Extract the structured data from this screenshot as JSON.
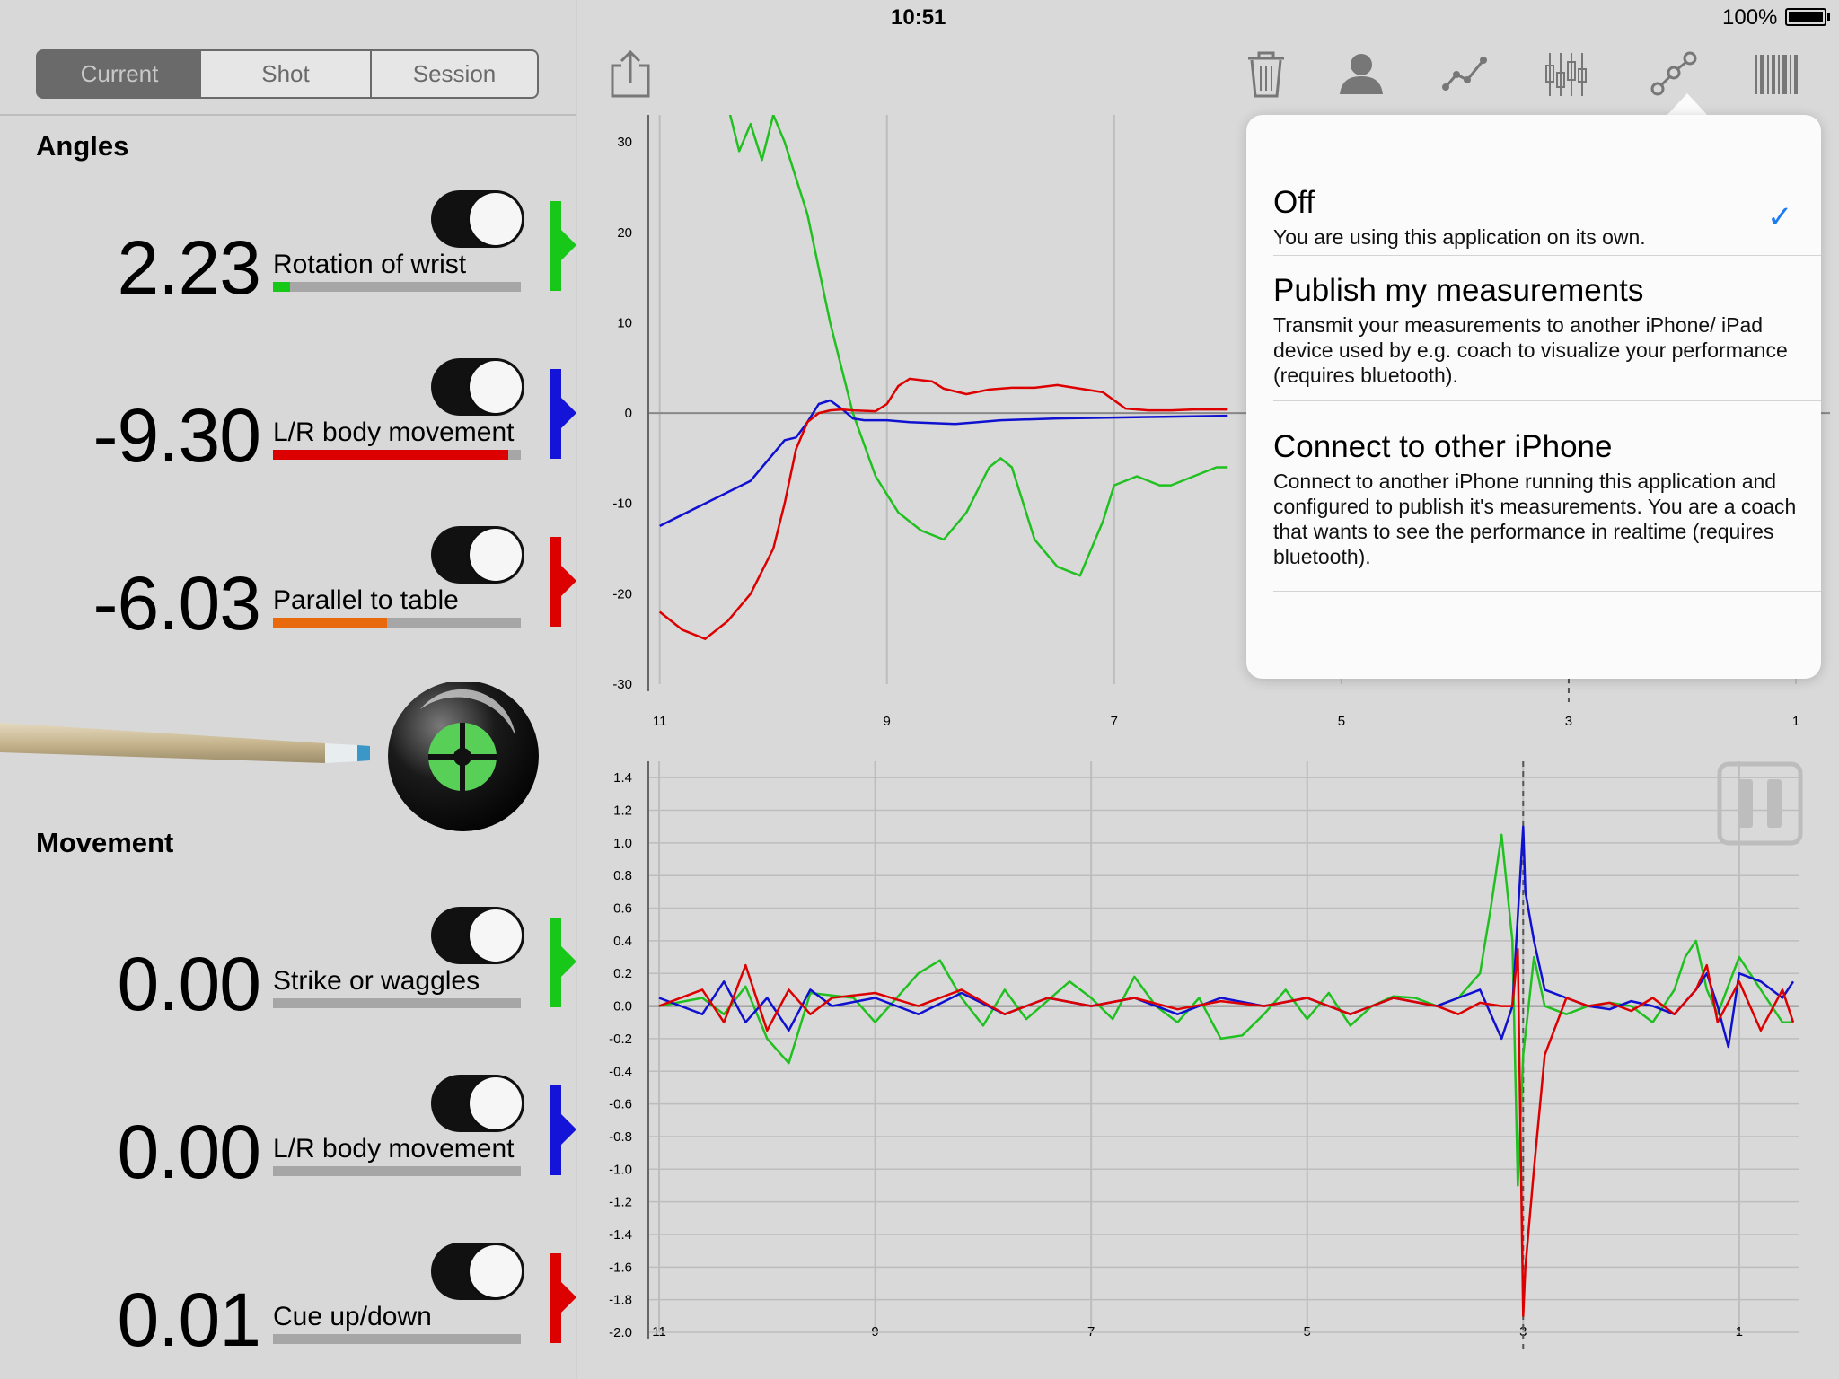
{
  "status_bar": {
    "device": "iPad",
    "time": "10:51",
    "battery": "100%"
  },
  "tabs": {
    "current": "Current",
    "shot": "Shot",
    "session": "Session",
    "active": "current"
  },
  "angles": {
    "title": "Angles",
    "items": [
      {
        "value": "2.23",
        "label": "Rotation of wrist",
        "bar_color": "#18c818",
        "bar_fill": 0.07,
        "flag_color": "#18c818",
        "enabled": true
      },
      {
        "value": "-9.30",
        "label": "L/R body movement",
        "bar_color": "#dd0000",
        "bar_fill": 0.95,
        "flag_color": "#1414d8",
        "enabled": true
      },
      {
        "value": "-6.03",
        "label": "Parallel to table",
        "bar_color": "#e86a0c",
        "bar_fill": 0.46,
        "flag_color": "#dd0000",
        "enabled": true
      }
    ]
  },
  "movement": {
    "title": "Movement",
    "items": [
      {
        "value": "0.00",
        "label": "Strike or waggles",
        "bar_color": "#18c818",
        "bar_fill": 0.0,
        "flag_color": "#18c818",
        "enabled": true
      },
      {
        "value": "0.00",
        "label": "L/R body movement",
        "bar_color": "#1414d8",
        "bar_fill": 0.0,
        "flag_color": "#1414d8",
        "enabled": true
      },
      {
        "value": "0.01",
        "label": "Cue up/down",
        "bar_color": "#dd0000",
        "bar_fill": 0.0,
        "flag_color": "#dd0000",
        "enabled": true
      }
    ]
  },
  "toolbar": {
    "icons": [
      "share-icon",
      "trash-icon",
      "person-icon",
      "line-chart-icon",
      "candlestick-icon",
      "connect-icon",
      "barcode-icon"
    ]
  },
  "popover": {
    "options": [
      {
        "title": "Off",
        "desc": "You are using this application on its own.",
        "selected": true
      },
      {
        "title": "Publish my measurements",
        "desc": "Transmit your measurements to another iPhone/ iPad device used by e.g. coach to visualize your performance (requires bluetooth).",
        "selected": false
      },
      {
        "title": "Connect to other iPhone",
        "desc": "Connect to another iPhone running this application and configured to publish it's measurements. You are a coach that wants to see the performance in realtime (requires bluetooth).",
        "selected": false
      }
    ],
    "check_glyph": "✓"
  },
  "chart_data": [
    {
      "type": "line",
      "title": "",
      "xlabel": "",
      "ylabel": "",
      "x_ticks": [
        "11",
        "9",
        "7",
        "5",
        "3",
        "1"
      ],
      "y_ticks": [
        "30",
        "20",
        "10",
        "0",
        "-10",
        "-20",
        "-30"
      ],
      "xlim": [
        11.1,
        0.7
      ],
      "ylim": [
        -30,
        33
      ],
      "grid": true,
      "marker_x": 3,
      "series": [
        {
          "color": "#20c020",
          "x": [
            10.4,
            10.3,
            10.2,
            10.1,
            10.0,
            9.9,
            9.7,
            9.5,
            9.3,
            9.1,
            8.9,
            8.7,
            8.5,
            8.3,
            8.1,
            8.0,
            7.9,
            7.8,
            7.7,
            7.5,
            7.3,
            7.1,
            7.0,
            6.8,
            6.6,
            6.5,
            6.3,
            6.1,
            6.0
          ],
          "y": [
            34,
            29,
            32,
            28,
            33,
            30,
            22,
            10,
            0,
            -7,
            -11,
            -13,
            -14,
            -11,
            -6,
            -5,
            -6,
            -10,
            -14,
            -17,
            -18,
            -12,
            -8,
            -7,
            -8,
            -8,
            -7,
            -6,
            -6
          ]
        },
        {
          "color": "#1010d0",
          "x": [
            11.0,
            10.6,
            10.2,
            10.0,
            9.9,
            9.8,
            9.7,
            9.6,
            9.5,
            9.4,
            9.3,
            9.2,
            9.0,
            8.8,
            8.6,
            8.4,
            8.2,
            8.0,
            7.5,
            7.0,
            6.5,
            6.0
          ],
          "y": [
            -12.5,
            -10,
            -7.5,
            -4.5,
            -3,
            -2.7,
            -1,
            1,
            1.4,
            0.5,
            -0.6,
            -0.8,
            -0.8,
            -1,
            -1.1,
            -1.2,
            -1,
            -0.8,
            -0.6,
            -0.5,
            -0.4,
            -0.3
          ]
        },
        {
          "color": "#dd0000",
          "x": [
            11.0,
            10.8,
            10.6,
            10.4,
            10.2,
            10.0,
            9.9,
            9.8,
            9.7,
            9.6,
            9.5,
            9.4,
            9.3,
            9.1,
            9.0,
            8.9,
            8.8,
            8.6,
            8.5,
            8.3,
            8.1,
            7.9,
            7.7,
            7.5,
            7.3,
            7.1,
            6.9,
            6.7,
            6.5,
            6.3,
            6.0
          ],
          "y": [
            -22,
            -24,
            -25,
            -23,
            -20,
            -15,
            -10,
            -4,
            -1,
            0,
            0.3,
            0.4,
            0.3,
            0.2,
            1,
            3,
            3.8,
            3.5,
            2.7,
            2.1,
            2.6,
            2.8,
            2.8,
            3.1,
            2.7,
            2.3,
            0.5,
            0.3,
            0.3,
            0.4,
            0.4
          ]
        }
      ]
    },
    {
      "type": "line",
      "title": "",
      "xlabel": "",
      "ylabel": "",
      "x_ticks": [
        "11",
        "9",
        "7",
        "5",
        "3",
        "1"
      ],
      "y_ticks": [
        "1.4",
        "1.2",
        "1.0",
        "0.8",
        "0.6",
        "0.4",
        "0.2",
        "0.0",
        "-0.2",
        "-0.4",
        "-0.6",
        "-0.8",
        "-1.0",
        "-1.2",
        "-1.4",
        "-1.6",
        "-1.8",
        "-2.0"
      ],
      "xlim": [
        11.1,
        0.45
      ],
      "ylim": [
        -2.0,
        1.5
      ],
      "grid": true,
      "marker_x": 3,
      "series": [
        {
          "color": "#20c020",
          "x": [
            11.0,
            10.6,
            10.4,
            10.2,
            10.0,
            9.8,
            9.6,
            9.2,
            9.0,
            8.6,
            8.4,
            8.2,
            8.0,
            7.8,
            7.6,
            7.2,
            7.0,
            6.8,
            6.6,
            6.4,
            6.2,
            6.0,
            5.8,
            5.6,
            5.4,
            5.2,
            5.0,
            4.8,
            4.6,
            4.4,
            4.2,
            4.0,
            3.8,
            3.6,
            3.4,
            3.3,
            3.2,
            3.1,
            3.05,
            3.0,
            2.9,
            2.8,
            2.6,
            2.4,
            2.2,
            2.0,
            1.8,
            1.6,
            1.5,
            1.4,
            1.3,
            1.2,
            1.0,
            0.8,
            0.6,
            0.5
          ],
          "y": [
            0.0,
            0.05,
            -0.05,
            0.12,
            -0.2,
            -0.35,
            0.08,
            0.05,
            -0.1,
            0.2,
            0.28,
            0.05,
            -0.12,
            0.1,
            -0.08,
            0.15,
            0.05,
            -0.08,
            0.18,
            0.0,
            -0.1,
            0.05,
            -0.2,
            -0.18,
            -0.05,
            0.1,
            -0.08,
            0.08,
            -0.12,
            0.0,
            0.06,
            0.05,
            0.0,
            0.05,
            0.2,
            0.6,
            1.05,
            0.4,
            -1.1,
            -0.3,
            0.3,
            0.0,
            -0.05,
            0.0,
            0.02,
            0.0,
            -0.1,
            0.1,
            0.3,
            0.4,
            0.1,
            -0.05,
            0.3,
            0.1,
            -0.1,
            -0.1
          ]
        },
        {
          "color": "#1010d0",
          "x": [
            11.0,
            10.6,
            10.4,
            10.2,
            10.0,
            9.8,
            9.6,
            9.4,
            9.0,
            8.6,
            8.2,
            7.8,
            7.4,
            7.0,
            6.6,
            6.2,
            5.8,
            5.4,
            5.0,
            4.6,
            4.2,
            3.8,
            3.6,
            3.4,
            3.2,
            3.1,
            3.05,
            3.0,
            2.98,
            2.9,
            2.8,
            2.6,
            2.4,
            2.2,
            2.0,
            1.8,
            1.6,
            1.4,
            1.3,
            1.2,
            1.1,
            1.0,
            0.8,
            0.6,
            0.5
          ],
          "y": [
            0.05,
            -0.05,
            0.15,
            -0.1,
            0.05,
            -0.15,
            0.1,
            0.0,
            0.05,
            -0.05,
            0.08,
            -0.05,
            0.05,
            0.0,
            0.05,
            -0.05,
            0.05,
            0.0,
            0.05,
            -0.05,
            0.05,
            0.0,
            0.05,
            0.1,
            -0.2,
            0.0,
            0.55,
            1.1,
            0.7,
            0.4,
            0.1,
            0.05,
            0.0,
            -0.02,
            0.03,
            0.0,
            -0.05,
            0.1,
            0.2,
            0.0,
            -0.25,
            0.2,
            0.15,
            0.05,
            0.15
          ]
        },
        {
          "color": "#dd0000",
          "x": [
            11.0,
            10.6,
            10.4,
            10.2,
            10.0,
            9.8,
            9.6,
            9.4,
            9.0,
            8.6,
            8.2,
            7.8,
            7.4,
            7.0,
            6.6,
            6.2,
            5.8,
            5.4,
            5.0,
            4.6,
            4.2,
            3.8,
            3.6,
            3.4,
            3.2,
            3.1,
            3.05,
            3.02,
            3.0,
            2.98,
            2.9,
            2.8,
            2.6,
            2.4,
            2.2,
            2.0,
            1.8,
            1.6,
            1.4,
            1.3,
            1.2,
            1.0,
            0.8,
            0.6,
            0.5
          ],
          "y": [
            0.0,
            0.1,
            -0.1,
            0.25,
            -0.15,
            0.1,
            -0.05,
            0.05,
            0.08,
            0.0,
            0.1,
            -0.05,
            0.05,
            0.0,
            0.05,
            -0.02,
            0.03,
            0.0,
            0.05,
            -0.05,
            0.05,
            0.0,
            -0.05,
            0.02,
            0.0,
            0.0,
            0.35,
            -1.0,
            -1.9,
            -1.6,
            -1.0,
            -0.3,
            0.05,
            0.0,
            0.02,
            -0.03,
            0.05,
            -0.05,
            0.1,
            0.25,
            -0.1,
            0.15,
            -0.15,
            0.1,
            -0.1
          ]
        }
      ]
    }
  ]
}
